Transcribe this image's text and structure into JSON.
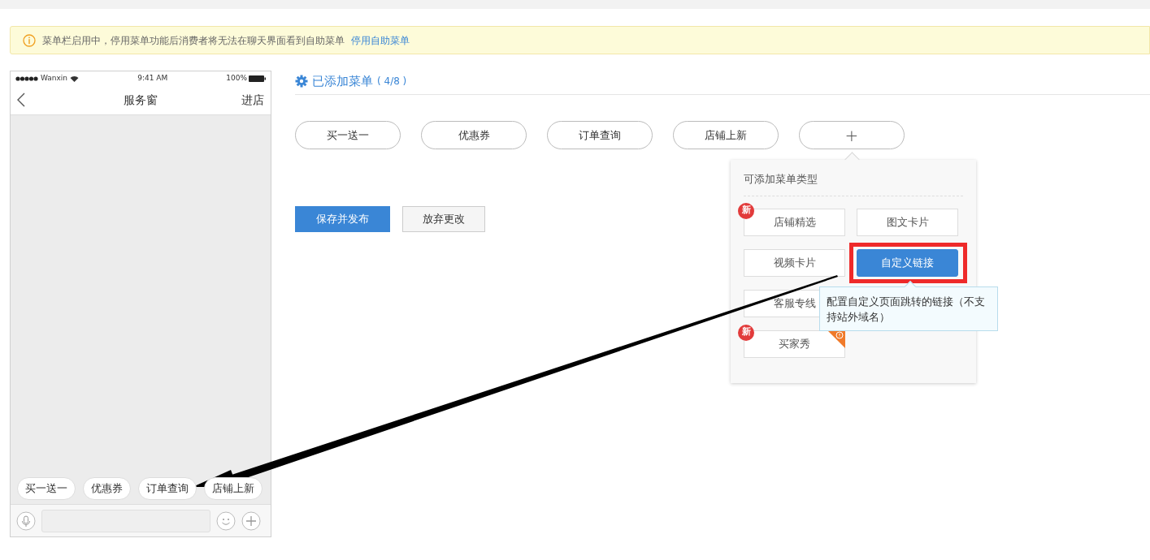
{
  "banner": {
    "text": "菜单栏启用中，停用菜单功能后消费者将无法在聊天界面看到自助菜单",
    "link": "停用自助菜单"
  },
  "phone": {
    "carrier": "Wanxin",
    "time": "9:41 AM",
    "battery": "100%",
    "title": "服务窗",
    "action": "进店",
    "chips": [
      "买一送一",
      "优惠券",
      "订单查询",
      "店铺上新"
    ]
  },
  "menu": {
    "title": "已添加菜单",
    "count": "( 4/8 )",
    "items": [
      {
        "label": "买一送一"
      },
      {
        "label": "优惠券"
      },
      {
        "label": "订单查询"
      },
      {
        "label": "店铺上新"
      }
    ],
    "add": "+"
  },
  "buttons": [
    {
      "label": "保存并发布",
      "kind": "primary"
    },
    {
      "label": "放弃更改",
      "kind": "secondary"
    }
  ],
  "popover": {
    "title": "可添加菜单类型",
    "type_rows": [
      [
        {
          "label": "店铺精选",
          "badge": "新",
          "selected": false,
          "warning": false
        },
        {
          "label": "图文卡片",
          "selected": false,
          "warning": false
        }
      ],
      [
        {
          "label": "视频卡片",
          "selected": false,
          "warning": false
        },
        {
          "label": "自定义链接",
          "selected": true,
          "warning": false
        }
      ],
      [
        {
          "label": "客服专线",
          "selected": false,
          "warning": false
        }
      ],
      [
        {
          "label": "买家秀",
          "badge": "新",
          "selected": false,
          "warning": true
        }
      ]
    ],
    "tooltip": "配置自定义页面跳转的链接（不支持站外域名）"
  }
}
